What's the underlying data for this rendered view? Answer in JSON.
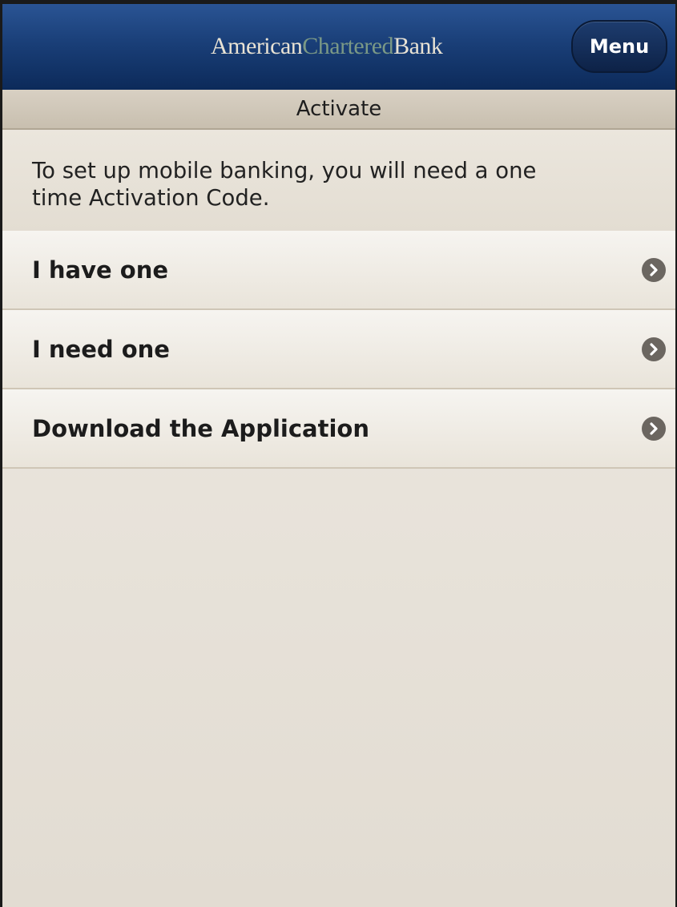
{
  "header": {
    "logo": {
      "word1": "American",
      "word2": "Chartered",
      "word3": "Bank"
    },
    "menu_label": "Menu"
  },
  "subheader": {
    "title": "Activate"
  },
  "intro": {
    "line1": "To set up mobile banking, you will need a one",
    "line2": "time Activation Code."
  },
  "list": {
    "items": [
      {
        "label": "I have one",
        "icon": "chevron-right-icon"
      },
      {
        "label": "I need one",
        "icon": "chevron-right-icon"
      },
      {
        "label": "Download the Application",
        "icon": "chevron-right-icon"
      }
    ]
  },
  "colors": {
    "header_blue": "#1a3f78",
    "logo_green": "#7a9886",
    "background": "#e2dcd2"
  }
}
